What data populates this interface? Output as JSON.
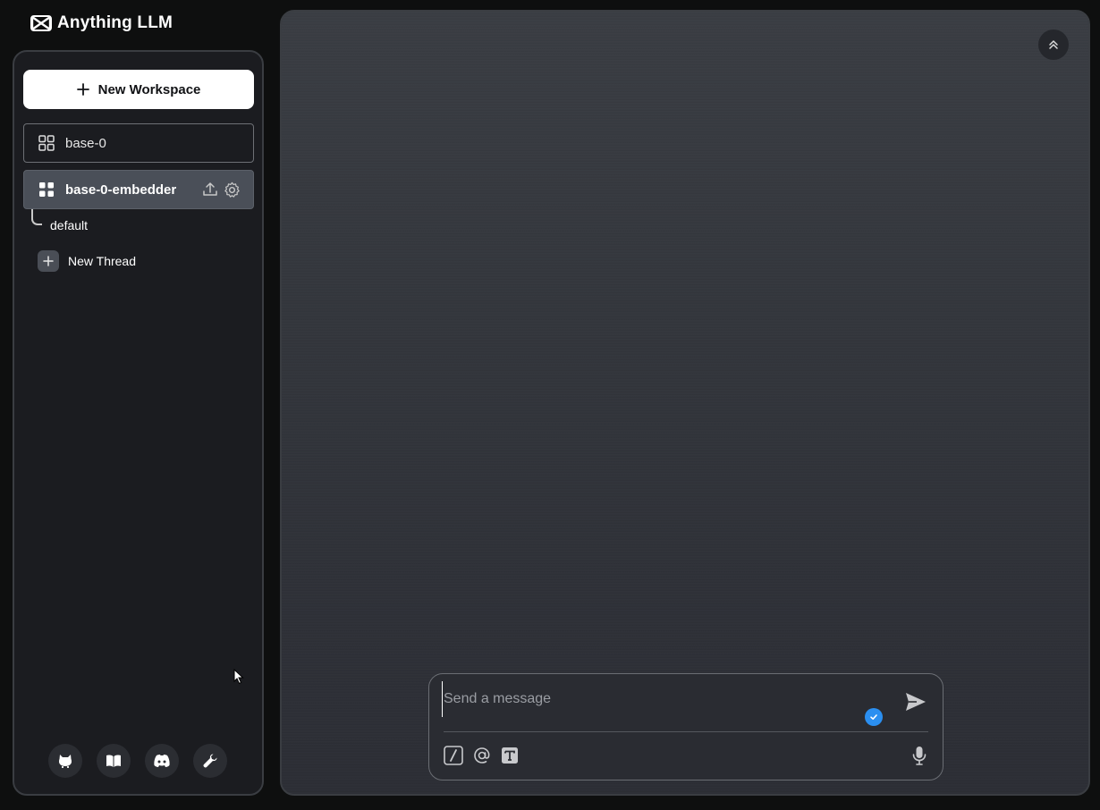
{
  "app": {
    "title": "Anything LLM"
  },
  "sidebar": {
    "new_workspace_label": "New Workspace",
    "workspaces": [
      {
        "name": "base-0",
        "active": false
      },
      {
        "name": "base-0-embedder",
        "active": true
      }
    ],
    "threads": [
      {
        "name": "default"
      }
    ],
    "new_thread_label": "New Thread",
    "footer_icons": [
      "github-icon",
      "docs-book-icon",
      "discord-icon",
      "settings-wrench-icon"
    ]
  },
  "composer": {
    "placeholder": "Send a message",
    "value": ""
  },
  "colors": {
    "background": "#0e0f0f",
    "sidebar": "#1b1c20",
    "main": "#33363c",
    "accent_blue": "#2b8ff0",
    "active_item": "#4a4f58"
  }
}
